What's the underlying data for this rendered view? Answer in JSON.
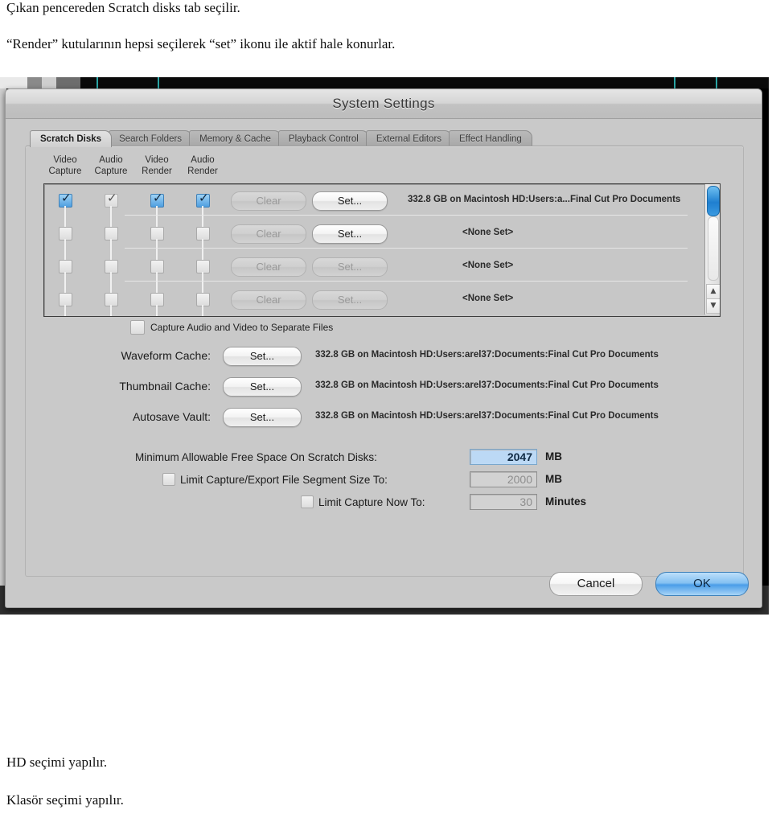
{
  "document": {
    "line1": "Çıkan pencereden Scratch disks tab seçilir.",
    "line2": "“Render”  kutularının hepsi seçilerek “set”  ikonu ile aktif hale konurlar.",
    "line3": "HD seçimi yapılır.",
    "line4": "Klasör seçimi yapılır."
  },
  "dialog": {
    "title": "System Settings",
    "tabs": [
      {
        "label": "Scratch Disks",
        "active": true
      },
      {
        "label": "Search Folders",
        "active": false
      },
      {
        "label": "Memory & Cache",
        "active": false
      },
      {
        "label": "Playback Control",
        "active": false
      },
      {
        "label": "External Editors",
        "active": false
      },
      {
        "label": "Effect Handling",
        "active": false
      }
    ],
    "column_headers": [
      {
        "line1": "Video",
        "line2": "Capture"
      },
      {
        "line1": "Audio",
        "line2": "Capture"
      },
      {
        "line1": "Video",
        "line2": "Render"
      },
      {
        "line1": "Audio",
        "line2": "Render"
      }
    ],
    "disk_rows": [
      {
        "checks": [
          "on",
          "on-dim",
          "on",
          "on"
        ],
        "clear_label": "Clear",
        "clear_enabled": false,
        "set_label": "Set...",
        "set_enabled": true,
        "path": "332.8 GB on  Macintosh HD:Users:a...Final Cut Pro Documents"
      },
      {
        "checks": [
          "off",
          "off",
          "off",
          "off"
        ],
        "clear_label": "Clear",
        "clear_enabled": false,
        "set_label": "Set...",
        "set_enabled": true,
        "path": "<None Set>"
      },
      {
        "checks": [
          "off",
          "off",
          "off",
          "off"
        ],
        "clear_label": "Clear",
        "clear_enabled": false,
        "set_label": "Set...",
        "set_enabled": false,
        "path": "<None Set>"
      },
      {
        "checks": [
          "off",
          "off",
          "off",
          "off"
        ],
        "clear_label": "Clear",
        "clear_enabled": false,
        "set_label": "Set...",
        "set_enabled": false,
        "path": "<None Set>"
      }
    ],
    "separate_files": {
      "label": "Capture Audio and Video to Separate Files",
      "checked": false
    },
    "cache_rows": [
      {
        "label": "Waveform Cache:",
        "button": "Set...",
        "path": "332.8 GB on  Macintosh HD:Users:arel37:Documents:Final Cut Pro Documents"
      },
      {
        "label": "Thumbnail Cache:",
        "button": "Set...",
        "path": "332.8 GB on  Macintosh HD:Users:arel37:Documents:Final Cut Pro Documents"
      },
      {
        "label": "Autosave Vault:",
        "button": "Set...",
        "path": "332.8 GB on  Macintosh HD:Users:arel37:Documents:Final Cut Pro Documents"
      }
    ],
    "limits": [
      {
        "label": "Minimum Allowable Free Space On Scratch Disks:",
        "value": "2047",
        "unit": "MB",
        "has_checkbox": false,
        "checked": false,
        "focused": true,
        "enabled": true
      },
      {
        "label": "Limit Capture/Export File Segment Size To:",
        "value": "2000",
        "unit": "MB",
        "has_checkbox": true,
        "checked": false,
        "focused": false,
        "enabled": false
      },
      {
        "label": "Limit Capture Now To:",
        "value": "30",
        "unit": "Minutes",
        "has_checkbox": true,
        "checked": false,
        "focused": false,
        "enabled": false
      }
    ],
    "footer": {
      "cancel_label": "Cancel",
      "ok_label": "OK"
    },
    "scrollbar": {
      "up_glyph": "▲",
      "down_glyph": "▼"
    }
  },
  "colors": {
    "dialog_bg": "#c9c9c9",
    "accent_blue": "#3a9ae0",
    "ok_blue": "#4a9de8",
    "title_text": "#3a3a3a"
  }
}
